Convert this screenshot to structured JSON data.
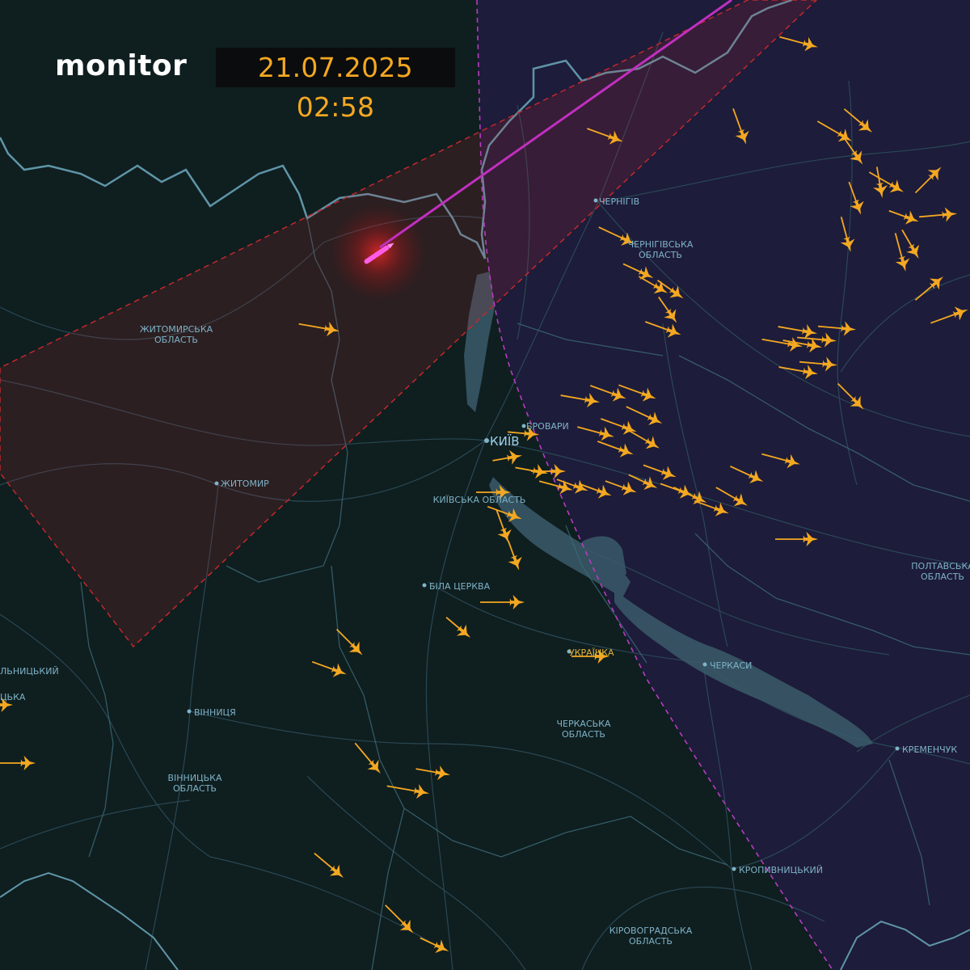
{
  "header": {
    "brand": "monitor",
    "timestamp": "21.07.2025 02:58"
  },
  "colors": {
    "background_west": "#0f1e1f",
    "background_east": "#1d1c3a",
    "border": "#5f95a8",
    "roads": "#2c4d5a",
    "water": "#3a5a6a",
    "drone": "#f4a821",
    "missile": "#e34cdc",
    "danger_zone": "#c0282d",
    "front_line": "#b63cc0"
  },
  "icons": {
    "drone": "shahed-drone-icon",
    "missile": "cruise-missile-icon",
    "city": "city-dot-icon"
  },
  "cities": [
    {
      "name": "ЧЕРНІГІВ"
    },
    {
      "name": "БРОВАРИ"
    },
    {
      "name": "КИЇВ"
    },
    {
      "name": "ЖИТОМИР"
    },
    {
      "name": "БІЛА ЦЕРКВА"
    },
    {
      "name": "ВІННИЦЯ"
    },
    {
      "name": "ЧЕРКАСИ"
    },
    {
      "name": "КРЕМЕНЧУК"
    },
    {
      "name": "КРОПИВНИЦЬКИЙ"
    },
    {
      "name": "УКРАЇНКА"
    }
  ],
  "regions": [
    {
      "line1": "ЖИТОМИРСЬКА",
      "line2": "ОБЛАСТЬ"
    },
    {
      "line1": "ЧЕРНІГІВСЬКА",
      "line2": "ОБЛАСТЬ"
    },
    {
      "line1": "КИЇВСЬКА ОБЛАСТЬ",
      "line2": ""
    },
    {
      "line1": "ПОЛТАВСЬКА",
      "line2": "ОБЛАСТЬ"
    },
    {
      "line1": "ЧЕРКАСЬКА",
      "line2": "ОБЛАСТЬ"
    },
    {
      "line1": "ВІННИЦЬКА",
      "line2": "ОБЛАСТЬ"
    },
    {
      "line1": "КІРОВОГРАДСЬКА",
      "line2": "ОБЛАСТЬ"
    },
    {
      "line1": "ЛЬНИЦЬКИЙ",
      "line2": ""
    },
    {
      "line1": "ЦЬКА",
      "line2": ""
    }
  ]
}
